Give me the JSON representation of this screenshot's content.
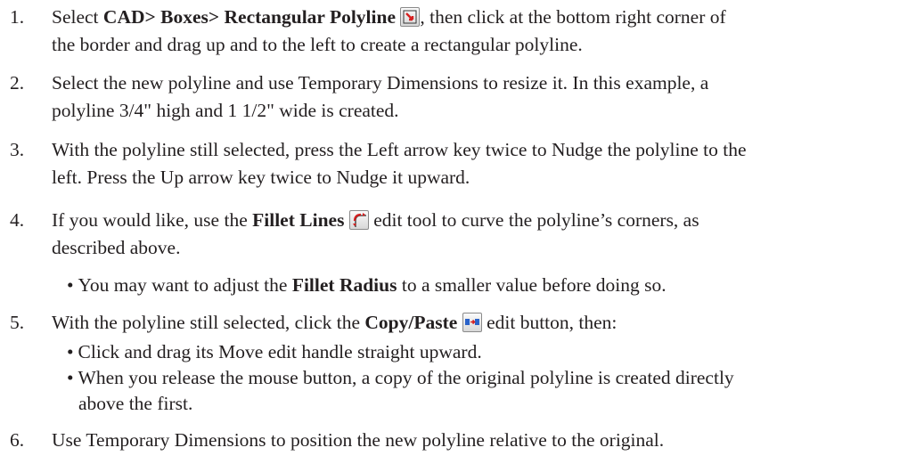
{
  "steps": [
    {
      "num": "1.",
      "a": "Select ",
      "b": "CAD> Boxes> Rectangular Polyline",
      "icon": "rectangular-polyline-icon",
      "c": ", then click at the bottom right corner of",
      "line2": "the border and drag up and to the left to create a rectangular polyline."
    },
    {
      "num": "2.",
      "line1": "Select the new polyline and use Temporary Dimensions to resize it. In this example, a",
      "line2": "polyline 3/4\" high and 1 1/2\" wide is created."
    },
    {
      "num": "3.",
      "line1": "With the polyline still selected, press the Left arrow key twice to Nudge the polyline to the",
      "line2": "left. Press the Up arrow key twice to Nudge it upward."
    },
    {
      "num": "4.",
      "a": "If you would like, use the ",
      "b": "Fillet Lines",
      "icon": "fillet-lines-icon",
      "c": " edit tool to curve the polyline’s corners, as",
      "line2": "described above.",
      "sub": {
        "bullet": "•",
        "a": "You may want to adjust the ",
        "b": "Fillet Radius",
        "c": " to a smaller value before doing so."
      }
    },
    {
      "num": "5.",
      "a": "With the polyline still selected, click the ",
      "b": "Copy/Paste",
      "icon": "copy-paste-icon",
      "c": " edit button, then:",
      "sub1": {
        "bullet": "•",
        "text": "Click and drag its Move edit handle straight upward."
      },
      "sub2": {
        "bullet": "•",
        "text": "When you release the mouse button, a copy of the original polyline is created directly",
        "cont": "above the first."
      }
    },
    {
      "num": "6.",
      "line1": "Use Temporary Dimensions to position the new polyline relative to the original."
    }
  ]
}
